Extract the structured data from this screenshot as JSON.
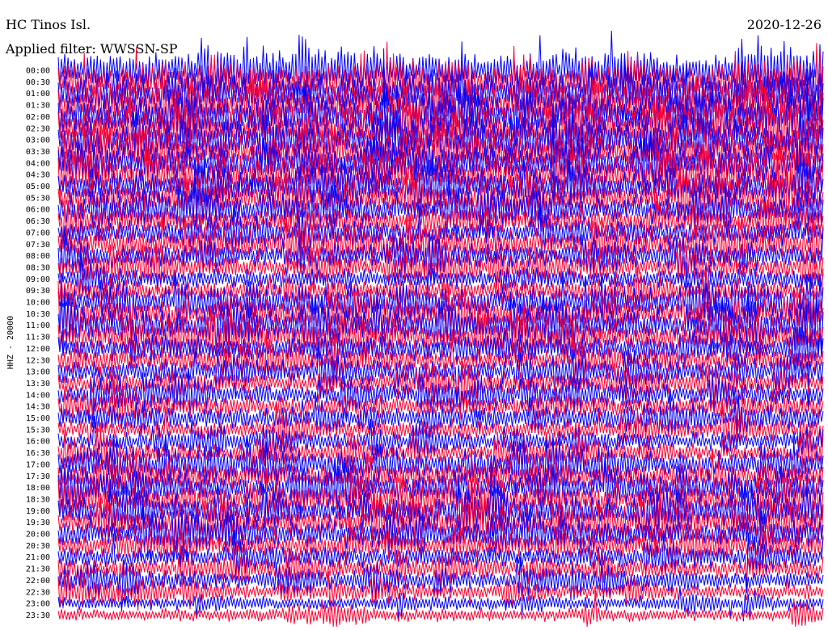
{
  "header": {
    "station": "HC Tinos Isl.",
    "date": "2020-12-26",
    "filter_label": "Applied filter: WWSSN-SP"
  },
  "chart_data": {
    "type": "line",
    "title": "HC Tinos Isl.",
    "subtitle": "Applied filter: WWSSN-SP",
    "date": "2020-12-26",
    "ylabel": "HHZ - 20000",
    "xlabel": "",
    "grid": false,
    "legend": "none",
    "rows": [
      "00:00",
      "00:30",
      "01:00",
      "01:30",
      "02:00",
      "02:30",
      "03:00",
      "03:30",
      "04:00",
      "04:30",
      "05:00",
      "05:30",
      "06:00",
      "06:30",
      "07:00",
      "07:30",
      "08:00",
      "08:30",
      "09:00",
      "09:30",
      "10:00",
      "10:30",
      "11:00",
      "11:30",
      "12:00",
      "12:30",
      "13:00",
      "13:30",
      "14:00",
      "14:30",
      "15:00",
      "15:30",
      "16:00",
      "16:30",
      "17:00",
      "17:30",
      "18:00",
      "18:30",
      "19:00",
      "19:30",
      "20:00",
      "20:30",
      "21:00",
      "21:30",
      "22:00",
      "22:30",
      "23:00",
      "23:30"
    ],
    "row_colors": [
      "#0000ff",
      "#ff0033"
    ],
    "activity_level": [
      0.95,
      0.95,
      0.95,
      0.95,
      0.95,
      0.95,
      0.93,
      0.92,
      0.9,
      0.88,
      0.8,
      0.75,
      0.65,
      0.62,
      0.6,
      0.72,
      0.55,
      0.5,
      0.48,
      0.45,
      0.72,
      0.75,
      0.78,
      0.7,
      0.62,
      0.6,
      0.55,
      0.5,
      0.48,
      0.55,
      0.52,
      0.45,
      0.42,
      0.4,
      0.62,
      0.65,
      0.68,
      0.7,
      0.72,
      0.7,
      0.68,
      0.55,
      0.5,
      0.45,
      0.4,
      0.3,
      0.26,
      0.24
    ]
  }
}
